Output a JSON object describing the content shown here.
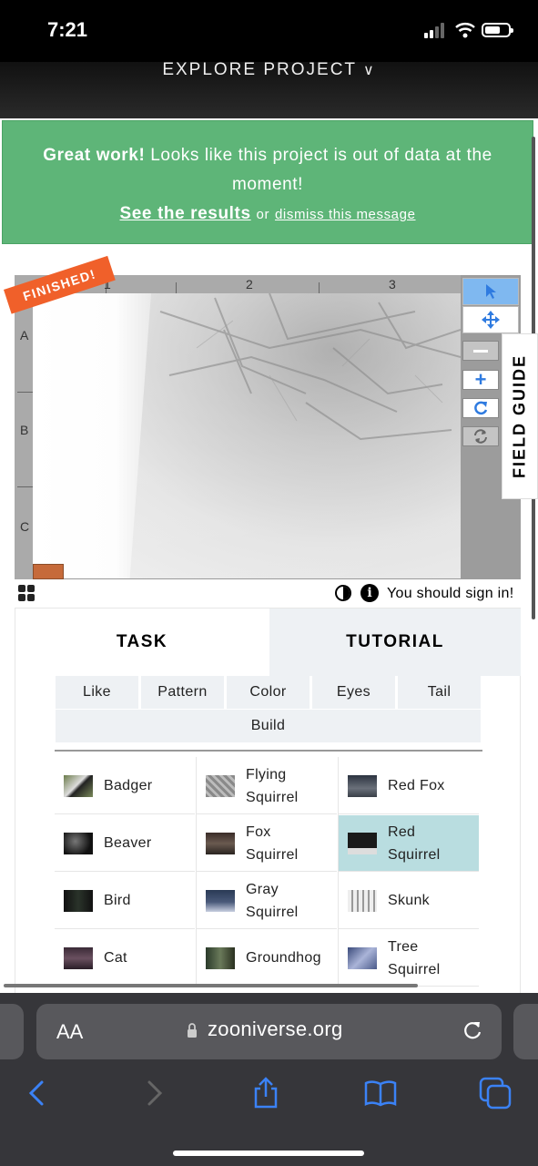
{
  "status_bar": {
    "time": "7:21"
  },
  "header": {
    "explore_label": "EXPLORE PROJECT",
    "chevron": "chevron-down-icon"
  },
  "banner": {
    "bold": "Great work!",
    "message": " Looks like this project is out of data at the moment!",
    "results_link": "See the results",
    "or_text": "or",
    "dismiss_link": "dismiss this message"
  },
  "viewer": {
    "finished_badge": "FINISHED!",
    "col_labels": [
      "1",
      "2",
      "3"
    ],
    "row_labels": [
      "A",
      "B",
      "C"
    ],
    "field_guide": "FIELD GUIDE",
    "signin_text": "You should sign in!"
  },
  "tabs": {
    "task": "TASK",
    "tutorial": "TUTORIAL"
  },
  "filters": [
    "Like",
    "Pattern",
    "Color",
    "Eyes",
    "Tail",
    "Build"
  ],
  "choices": [
    {
      "label": "Badger",
      "selected": false
    },
    {
      "label": "Flying Squirrel",
      "selected": false
    },
    {
      "label": "Red Fox",
      "selected": false
    },
    {
      "label": "Beaver",
      "selected": false
    },
    {
      "label": "Fox Squirrel",
      "selected": false
    },
    {
      "label": "Red Squirrel",
      "selected": true
    },
    {
      "label": "Bird",
      "selected": false
    },
    {
      "label": "Gray Squirrel",
      "selected": false
    },
    {
      "label": "Skunk",
      "selected": false
    },
    {
      "label": "Cat",
      "selected": false
    },
    {
      "label": "Groundhog",
      "selected": false
    },
    {
      "label": "Tree Squirrel",
      "selected": false
    }
  ],
  "browser": {
    "aa_label": "AA",
    "url": "zooniverse.org"
  },
  "colors": {
    "banner": "#5eb578",
    "finished": "#f0602a",
    "selected": "#b9dde0",
    "ios_blue": "#3b82f6"
  }
}
